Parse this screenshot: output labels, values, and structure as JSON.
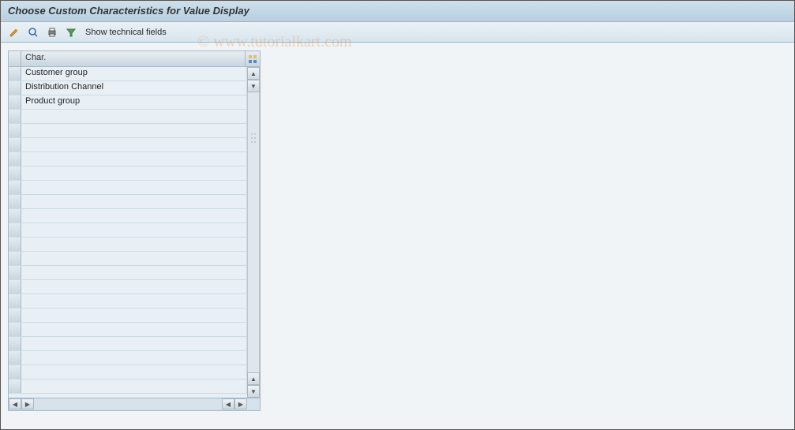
{
  "title": "Choose Custom Characteristics for Value Display",
  "toolbar": {
    "show_tech_label": "Show technical fields"
  },
  "table": {
    "header": "Char.",
    "rows": [
      "Customer group",
      "Distribution Channel",
      "Product group",
      "",
      "",
      "",
      "",
      "",
      "",
      "",
      "",
      "",
      "",
      "",
      "",
      "",
      "",
      "",
      "",
      "",
      "",
      "",
      ""
    ]
  },
  "watermark": "© www.tutorialkart.com"
}
